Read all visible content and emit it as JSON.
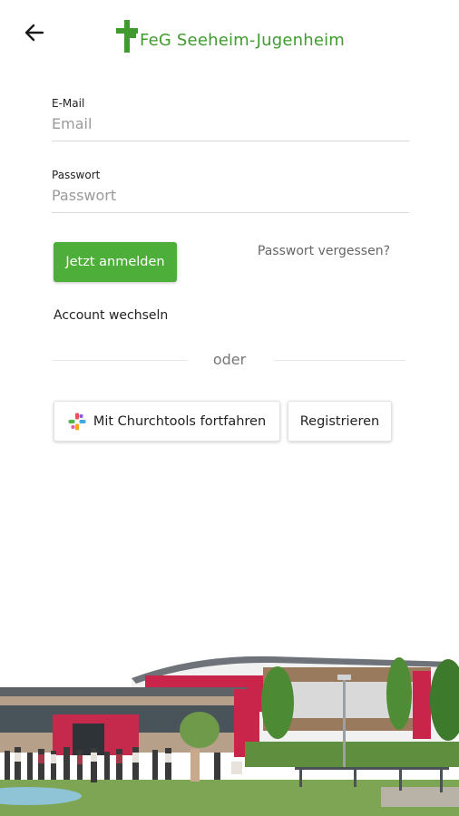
{
  "header": {
    "back_icon": "arrow-left-icon",
    "logo_text": "FeG Seeheim-Jugenheim",
    "brand_color": "#3f9b2e"
  },
  "form": {
    "email": {
      "label": "E-Mail",
      "placeholder": "Email",
      "value": ""
    },
    "password": {
      "label": "Passwort",
      "placeholder": "Passwort",
      "value": ""
    },
    "login_button": "Jetzt anmelden",
    "forgot_password": "Passwort vergessen?",
    "switch_account": "Account wechseln",
    "divider_text": "oder",
    "churchtools_button": "Mit Churchtools fortfahren",
    "churchtools_icon": "churchtools-logo-icon",
    "register_button": "Registrieren",
    "accent_color": "#4eae3a"
  },
  "footer": {
    "image": "church-building-photo"
  }
}
